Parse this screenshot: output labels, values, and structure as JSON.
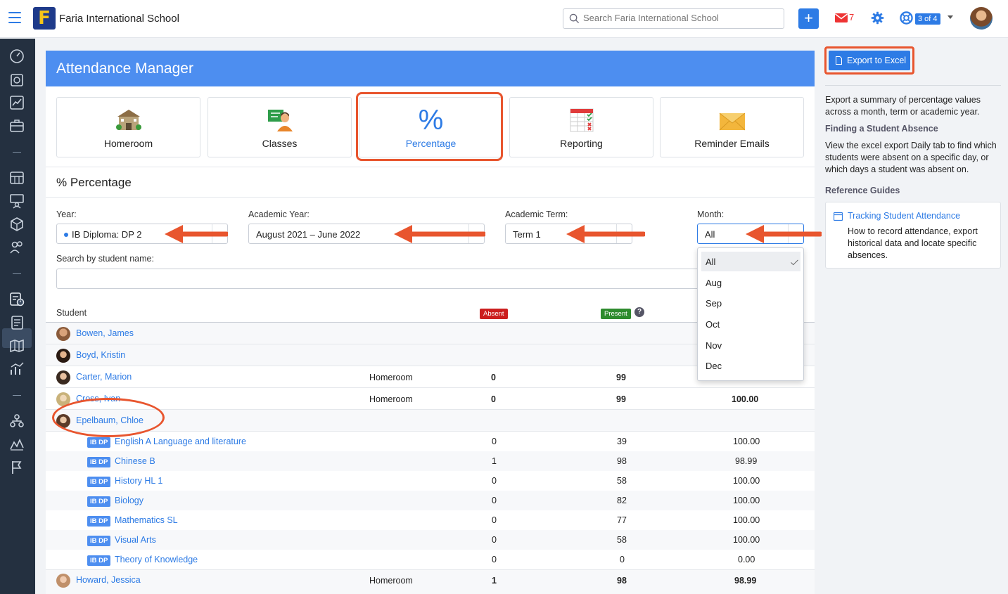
{
  "topbar": {
    "school_name": "Faria International School",
    "logo_letter": "F",
    "search_placeholder": "Search Faria International School",
    "add_label": "+",
    "mail_count": "7",
    "pager": "3 of 4"
  },
  "page": {
    "title": "Attendance Manager",
    "section_title": "% Percentage"
  },
  "tiles": [
    {
      "label": "Homeroom",
      "icon": "school-building-icon"
    },
    {
      "label": "Classes",
      "icon": "classroom-teacher-icon"
    },
    {
      "label": "Percentage",
      "icon": "percent-icon",
      "glyph": "%"
    },
    {
      "label": "Reporting",
      "icon": "report-sheet-icon"
    },
    {
      "label": "Reminder Emails",
      "icon": "envelope-icon"
    }
  ],
  "filters": {
    "year_label": "Year:",
    "year_value": "IB Diploma: DP 2",
    "academic_year_label": "Academic Year:",
    "academic_year_value": "August 2021 – June 2022",
    "term_label": "Academic Term:",
    "term_value": "Term 1",
    "month_label": "Month:",
    "month_value": "All",
    "search_label": "Search by student name:"
  },
  "month_options": [
    "All",
    "Aug",
    "Sep",
    "Oct",
    "Nov",
    "Dec"
  ],
  "table": {
    "col_student": "Student",
    "badge_absent": "Absent",
    "badge_present": "Present",
    "help": "?",
    "rows": [
      {
        "name": "Bowen, James",
        "group": "",
        "absent": "",
        "present": "",
        "pct": ""
      },
      {
        "name": "Boyd, Kristin",
        "group": "",
        "absent": "",
        "present": "",
        "pct": ""
      },
      {
        "name": "Carter, Marion",
        "group": "Homeroom",
        "absent": "0",
        "present": "99",
        "pct": ""
      },
      {
        "name": "Cross, Ivan",
        "group": "Homeroom",
        "absent": "0",
        "present": "99",
        "pct": "100.00"
      },
      {
        "name": "Epelbaum, Chloe",
        "group": "",
        "absent": "",
        "present": "",
        "pct": ""
      }
    ],
    "classes": [
      {
        "tag": "IB DP",
        "name": "English A Language and literature",
        "absent": "0",
        "present": "39",
        "pct": "100.00"
      },
      {
        "tag": "IB DP",
        "name": "Chinese B",
        "absent": "1",
        "present": "98",
        "pct": "98.99"
      },
      {
        "tag": "IB DP",
        "name": "History HL 1",
        "absent": "0",
        "present": "58",
        "pct": "100.00"
      },
      {
        "tag": "IB DP",
        "name": "Biology",
        "absent": "0",
        "present": "82",
        "pct": "100.00"
      },
      {
        "tag": "IB DP",
        "name": "Mathematics SL",
        "absent": "0",
        "present": "77",
        "pct": "100.00"
      },
      {
        "tag": "IB DP",
        "name": "Visual Arts",
        "absent": "0",
        "present": "58",
        "pct": "100.00"
      },
      {
        "tag": "IB DP",
        "name": "Theory of Knowledge",
        "absent": "0",
        "present": "0",
        "pct": "0.00"
      }
    ],
    "last_row": {
      "name": "Howard, Jessica",
      "group": "Homeroom",
      "absent": "1",
      "present": "98",
      "pct": "98.99"
    }
  },
  "right_panel": {
    "export_label": "Export to Excel",
    "export_desc": "Export a summary of percentage values across a month, term or academic year.",
    "finding_title": "Finding a Student Absence",
    "finding_desc": "View the excel export Daily tab to find which students were absent on a specific day, or which days a student was absent on.",
    "guides_title": "Reference Guides",
    "guide_link": "Tracking Student Attendance",
    "guide_desc": "How to record attendance, export historical data and locate specific absences."
  },
  "colors": {
    "accent": "#2d7be5",
    "header_blue": "#4d8ef0",
    "highlight": "#e8552e",
    "absent_red": "#cc1f1f",
    "present_green": "#2e8b2e",
    "sidebar": "#243040"
  }
}
